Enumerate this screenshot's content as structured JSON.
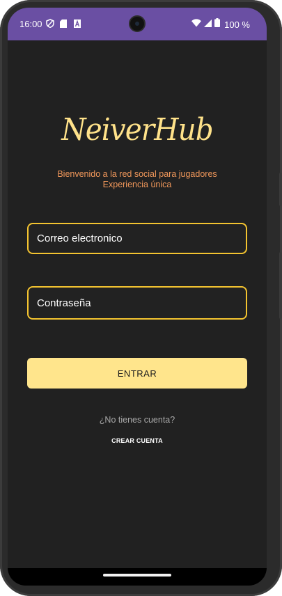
{
  "status_bar": {
    "time": "16:00",
    "battery": "100 %",
    "color": "#6a4fa3",
    "icons": [
      "vpn-shield-icon",
      "sd-card-icon",
      "font-icon",
      "wifi-icon",
      "signal-icon",
      "battery-icon"
    ]
  },
  "app": {
    "logo": "NeiverHub",
    "subtitle_line1": "Bienvenido a la red social para jugadores",
    "subtitle_line2": "Experiencia única",
    "accent_color": "#f4c430",
    "logo_color": "#ffe28a",
    "subtitle_color": "#f0975a",
    "background_color": "#212121"
  },
  "login_form": {
    "email_placeholder": "Correo electronico",
    "password_placeholder": "Contraseña",
    "submit_label": "ENTRAR"
  },
  "footer": {
    "no_account_text": "¿No tienes cuenta?",
    "create_account_label": "CREAR CUENTA"
  }
}
